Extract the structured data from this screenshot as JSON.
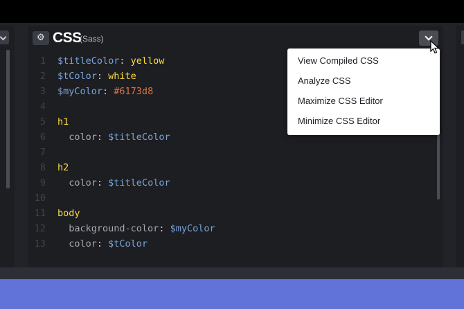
{
  "panel": {
    "title": "CSS",
    "subtitle": "(Sass)",
    "settings_icon": "gear-icon",
    "dropdown_icon": "chevron-down-icon"
  },
  "code_lines": [
    {
      "num": "1",
      "tokens": [
        [
          "var",
          "$titleColor"
        ],
        [
          "punc",
          ": "
        ],
        [
          "kw",
          "yellow"
        ]
      ]
    },
    {
      "num": "2",
      "tokens": [
        [
          "var",
          "$tColor"
        ],
        [
          "punc",
          ": "
        ],
        [
          "kw",
          "white"
        ]
      ]
    },
    {
      "num": "3",
      "tokens": [
        [
          "var",
          "$myColor"
        ],
        [
          "punc",
          ": "
        ],
        [
          "hex",
          "#6173d8"
        ]
      ]
    },
    {
      "num": "4",
      "tokens": []
    },
    {
      "num": "5",
      "tokens": [
        [
          "sel",
          "h1"
        ]
      ]
    },
    {
      "num": "6",
      "tokens": [
        [
          "prop",
          "  color"
        ],
        [
          "punc",
          ": "
        ],
        [
          "var",
          "$titleColor"
        ]
      ]
    },
    {
      "num": "7",
      "tokens": []
    },
    {
      "num": "8",
      "tokens": [
        [
          "sel",
          "h2"
        ]
      ]
    },
    {
      "num": "9",
      "tokens": [
        [
          "prop",
          "  color"
        ],
        [
          "punc",
          ": "
        ],
        [
          "var",
          "$titleColor"
        ]
      ]
    },
    {
      "num": "10",
      "tokens": []
    },
    {
      "num": "11",
      "tokens": [
        [
          "sel",
          "body"
        ]
      ]
    },
    {
      "num": "12",
      "tokens": [
        [
          "prop",
          "  background-color"
        ],
        [
          "punc",
          ": "
        ],
        [
          "var",
          "$myColor"
        ]
      ]
    },
    {
      "num": "13",
      "tokens": [
        [
          "prop",
          "  color"
        ],
        [
          "punc",
          ": "
        ],
        [
          "var",
          "$tColor"
        ]
      ]
    }
  ],
  "menu": {
    "items": [
      {
        "label": "View Compiled CSS"
      },
      {
        "label": "Analyze CSS"
      },
      {
        "label": "Maximize CSS Editor"
      },
      {
        "label": "Minimize CSS Editor"
      }
    ]
  },
  "colors": {
    "editor_bg": "#1d1e22",
    "preview_bg": "#6173d8",
    "keyword": "#ffdd40",
    "variable": "#79a4d8",
    "hex": "#e0733f"
  }
}
